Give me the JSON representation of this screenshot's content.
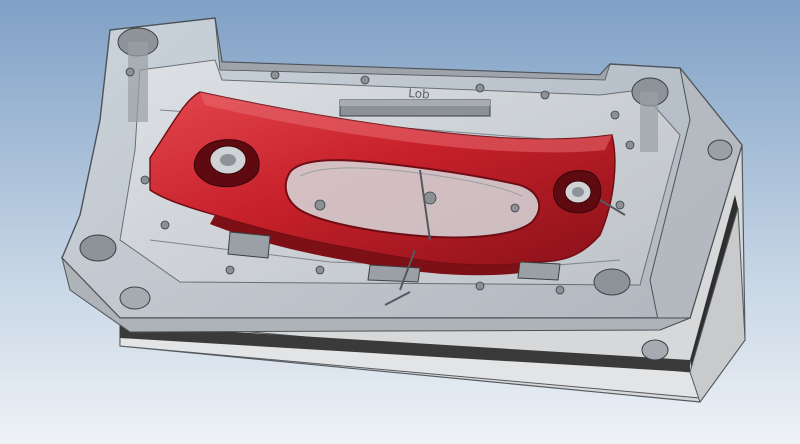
{
  "viewport": {
    "background_top": "#7fa0c6",
    "background_bottom": "#eef2f6"
  },
  "colors": {
    "part_red": "#c8212b",
    "part_red_dark": "#7d0f16",
    "part_red_light": "#ea6a6f",
    "mold_glass": "#c9ced3",
    "mold_edge": "#4d5257",
    "base_plate": "#d9d9d9",
    "base_band": "#3a3a3a"
  },
  "engraving": "Lob"
}
